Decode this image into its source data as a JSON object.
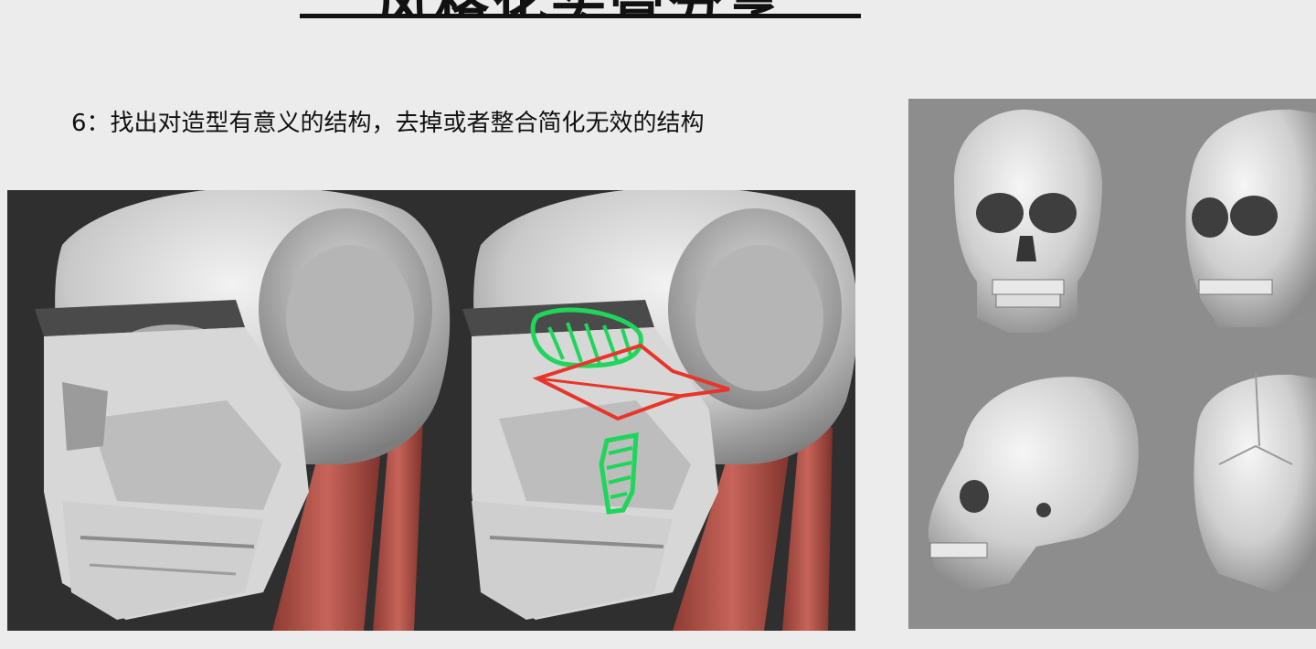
{
  "slide": {
    "title": "风格化头骨分享",
    "step_text": "6：找出对造型有意义的结构，去掉或者整合简化无效的结构"
  },
  "images": {
    "left": "stylized-skull-render",
    "middle": "stylized-skull-annotated",
    "right": "realistic-skull-reference-views"
  },
  "colors": {
    "background": "#ececec",
    "render_bg": "#2f2f2f",
    "reference_bg": "#8d8d8d",
    "annotation_green": "#1fd65a",
    "annotation_red": "#e8352a",
    "muscle": "#b8574e"
  }
}
